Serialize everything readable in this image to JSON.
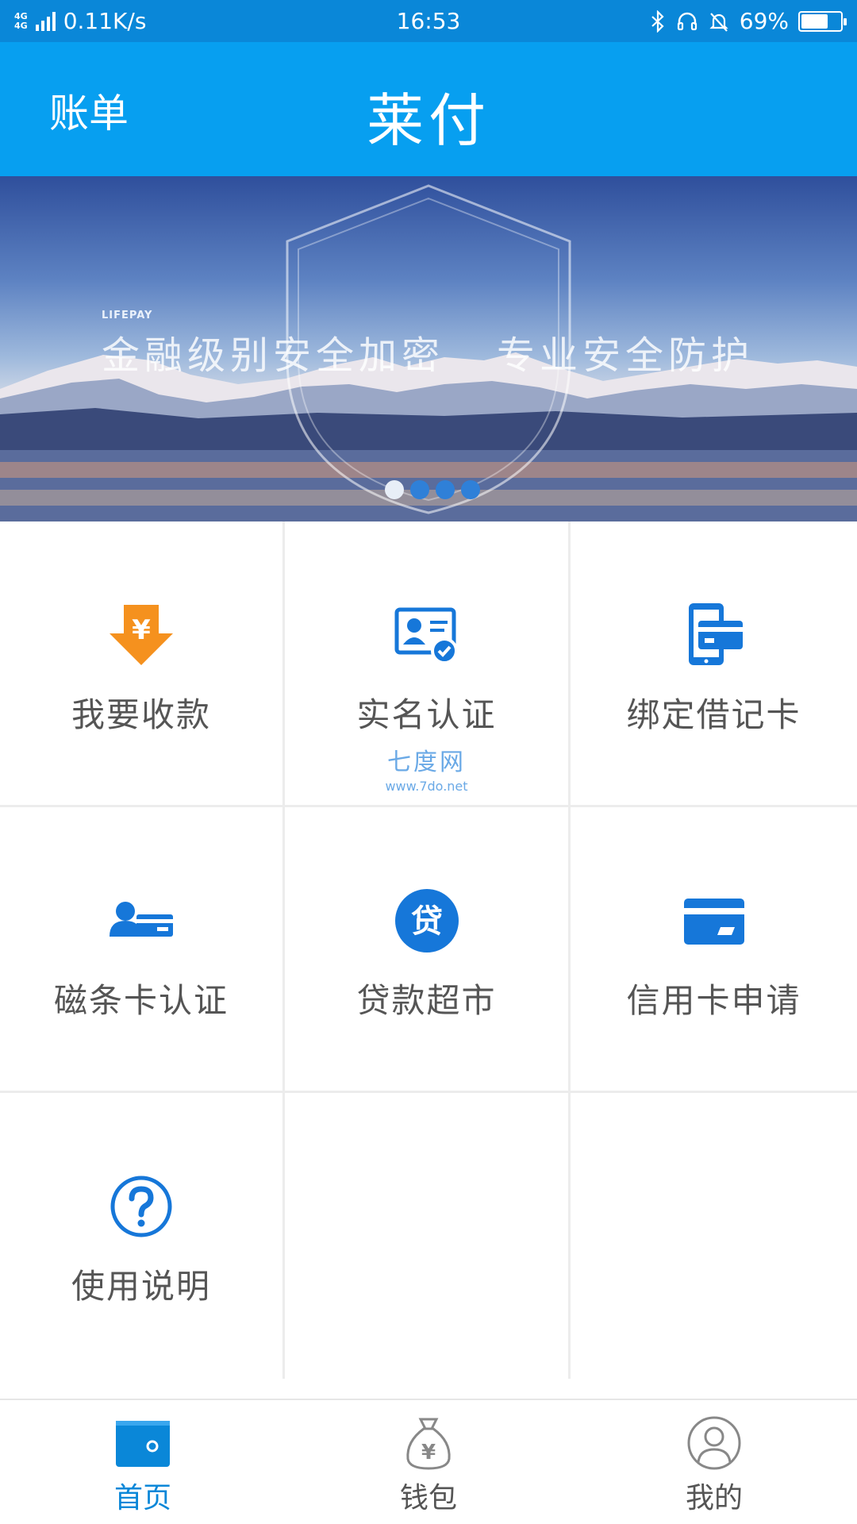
{
  "status_bar": {
    "network_label_1": "4G",
    "network_label_2": "4G",
    "speed": "0.11K/s",
    "time": "16:53",
    "battery_percent_text": "69%",
    "battery_level": 0.69,
    "icons": [
      "bluetooth-icon",
      "headset-icon",
      "mute-bell-icon",
      "battery-icon"
    ]
  },
  "header": {
    "left_label": "账单",
    "title": "莱付",
    "color": "#079ff0"
  },
  "banner": {
    "brand": "LIFEPAY",
    "text_left": "金融级别安全加密",
    "text_right": "专业安全防护",
    "dots": 4,
    "active_dot": 0
  },
  "grid": {
    "items": [
      {
        "label": "我要收款",
        "icon": "receive-money-icon",
        "color": "#f5911e"
      },
      {
        "label": "实名认证",
        "icon": "id-verify-icon",
        "color": "#1677d9"
      },
      {
        "label": "绑定借记卡",
        "icon": "bind-card-icon",
        "color": "#1677d9"
      },
      {
        "label": "磁条卡认证",
        "icon": "magstripe-card-icon",
        "color": "#1677d9"
      },
      {
        "label": "贷款超市",
        "icon": "loan-icon",
        "color": "#1677d9"
      },
      {
        "label": "信用卡申请",
        "icon": "credit-card-icon",
        "color": "#1677d9"
      },
      {
        "label": "使用说明",
        "icon": "help-icon",
        "color": "#1677d9"
      }
    ],
    "watermark_line1": "七度网",
    "watermark_line2": "www.7do.net"
  },
  "bottom_nav": {
    "items": [
      {
        "label": "首页",
        "icon": "wallet-home-icon",
        "active": true
      },
      {
        "label": "钱包",
        "icon": "money-bag-icon",
        "active": false
      },
      {
        "label": "我的",
        "icon": "profile-icon",
        "active": false
      }
    ],
    "active_color": "#0a87d8"
  }
}
